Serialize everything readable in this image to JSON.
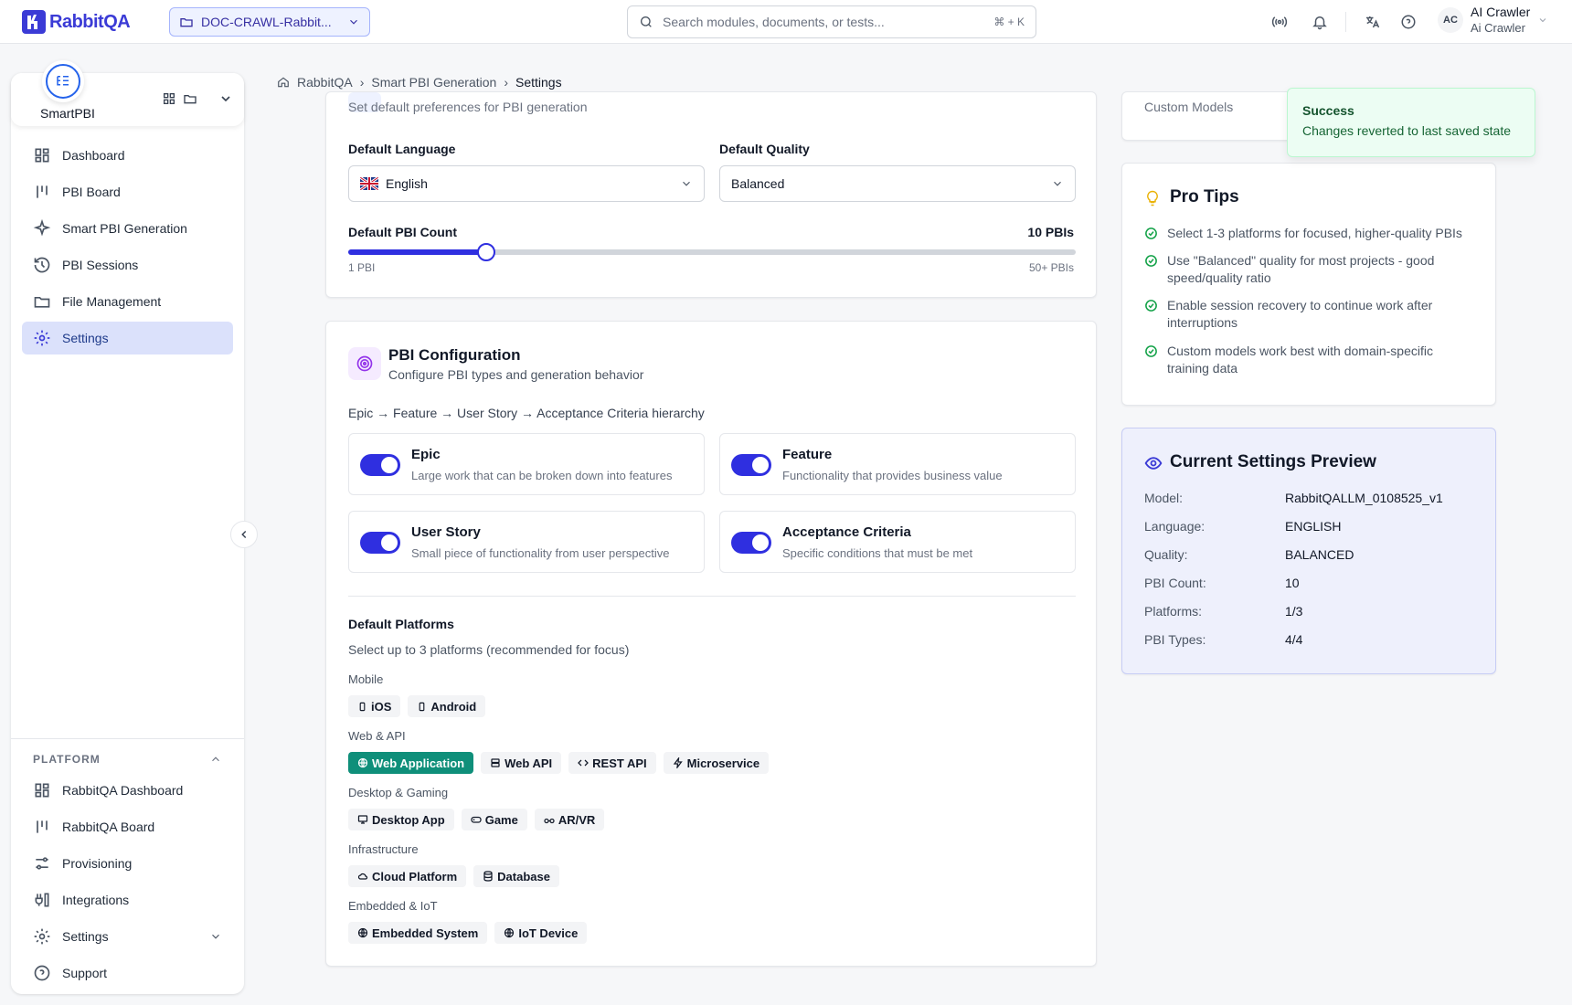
{
  "app": {
    "name": "RabbitQA"
  },
  "header": {
    "project": "DOC-CRAWL-Rabbit...",
    "search_placeholder": "Search modules, documents, or tests...",
    "search_shortcut": "⌘ + K",
    "user_initials": "AC",
    "user_name": "AI Crawler",
    "user_sub": "Ai Crawler"
  },
  "sidebar": {
    "brand": "SmartPBI",
    "items": [
      {
        "label": "Dashboard",
        "icon": "dashboard-icon"
      },
      {
        "label": "PBI Board",
        "icon": "board-icon"
      },
      {
        "label": "Smart PBI Generation",
        "icon": "sparkle-icon"
      },
      {
        "label": "PBI Sessions",
        "icon": "history-icon"
      },
      {
        "label": "File Management",
        "icon": "folder-icon"
      },
      {
        "label": "Settings",
        "icon": "gear-icon",
        "active": true
      }
    ],
    "platform_heading": "PLATFORM",
    "platform_items": [
      {
        "label": "RabbitQA Dashboard",
        "icon": "dashboard-icon"
      },
      {
        "label": "RabbitQA Board",
        "icon": "board-icon"
      },
      {
        "label": "Provisioning",
        "icon": "sliders-icon"
      },
      {
        "label": "Integrations",
        "icon": "plug-icon"
      },
      {
        "label": "Settings",
        "icon": "gear-icon"
      },
      {
        "label": "Support",
        "icon": "help-icon"
      }
    ]
  },
  "breadcrumb": {
    "home": "RabbitQA",
    "section": "Smart PBI Generation",
    "current": "Settings"
  },
  "defaults": {
    "subtitle": "Set default preferences for PBI generation",
    "language_label": "Default Language",
    "language_value": "English",
    "quality_label": "Default Quality",
    "quality_value": "Balanced",
    "count_label": "Default PBI Count",
    "count_value": "10 PBIs",
    "count_fraction": 0.19,
    "count_min": "1 PBI",
    "count_max": "50+ PBIs"
  },
  "config": {
    "title": "PBI Configuration",
    "subtitle": "Configure PBI types and generation behavior",
    "hierarchy": "Epic → Feature → User Story → Acceptance Criteria hierarchy",
    "types": [
      {
        "title": "Epic",
        "desc": "Large work that can be broken down into features",
        "enabled": true
      },
      {
        "title": "Feature",
        "desc": "Functionality that provides business value",
        "enabled": true
      },
      {
        "title": "User Story",
        "desc": "Small piece of functionality from user perspective",
        "enabled": true
      },
      {
        "title": "Acceptance Criteria",
        "desc": "Specific conditions that must be met",
        "enabled": true
      }
    ],
    "platforms_title": "Default Platforms",
    "platforms_sub": "Select up to 3 platforms (recommended for focus)",
    "groups": [
      {
        "label": "Mobile",
        "chips": [
          {
            "label": "iOS",
            "icon": "phone-icon"
          },
          {
            "label": "Android",
            "icon": "phone-icon"
          }
        ]
      },
      {
        "label": "Web & API",
        "chips": [
          {
            "label": "Web Application",
            "icon": "globe-icon",
            "selected": true
          },
          {
            "label": "Web API",
            "icon": "server-icon"
          },
          {
            "label": "REST API",
            "icon": "code-icon"
          },
          {
            "label": "Microservice",
            "icon": "bolt-icon"
          }
        ]
      },
      {
        "label": "Desktop & Gaming",
        "chips": [
          {
            "label": "Desktop App",
            "icon": "monitor-icon"
          },
          {
            "label": "Game",
            "icon": "gamepad-icon"
          },
          {
            "label": "AR/VR",
            "icon": "glasses-icon"
          }
        ]
      },
      {
        "label": "Infrastructure",
        "chips": [
          {
            "label": "Cloud Platform",
            "icon": "cloud-icon"
          },
          {
            "label": "Database",
            "icon": "database-icon"
          }
        ]
      },
      {
        "label": "Embedded & IoT",
        "chips": [
          {
            "label": "Embedded System",
            "icon": "globe-icon"
          },
          {
            "label": "IoT Device",
            "icon": "globe-icon"
          }
        ]
      }
    ]
  },
  "right": {
    "top_card_text": "Custom Models",
    "tips_title": "Pro Tips",
    "tips": [
      "Select 1-3 platforms for focused, higher-quality PBIs",
      "Use \"Balanced\" quality for most projects - good speed/quality ratio",
      "Enable session recovery to continue work after interruptions",
      "Custom models work best with domain-specific training data"
    ],
    "preview_title": "Current Settings Preview",
    "preview": [
      {
        "k": "Model:",
        "v": "RabbitQALLM_0108525_v1"
      },
      {
        "k": "Language:",
        "v": "ENGLISH"
      },
      {
        "k": "Quality:",
        "v": "BALANCED"
      },
      {
        "k": "PBI Count:",
        "v": "10"
      },
      {
        "k": "Platforms:",
        "v": "1/3"
      },
      {
        "k": "PBI Types:",
        "v": "4/4"
      }
    ]
  },
  "toast": {
    "title": "Success",
    "message": "Changes reverted to last saved state"
  },
  "colors": {
    "accent": "#2f2fe0",
    "brand": "#3b3bd6",
    "selected_chip": "#0f8f7a",
    "success_bg": "#ecfdf3"
  }
}
